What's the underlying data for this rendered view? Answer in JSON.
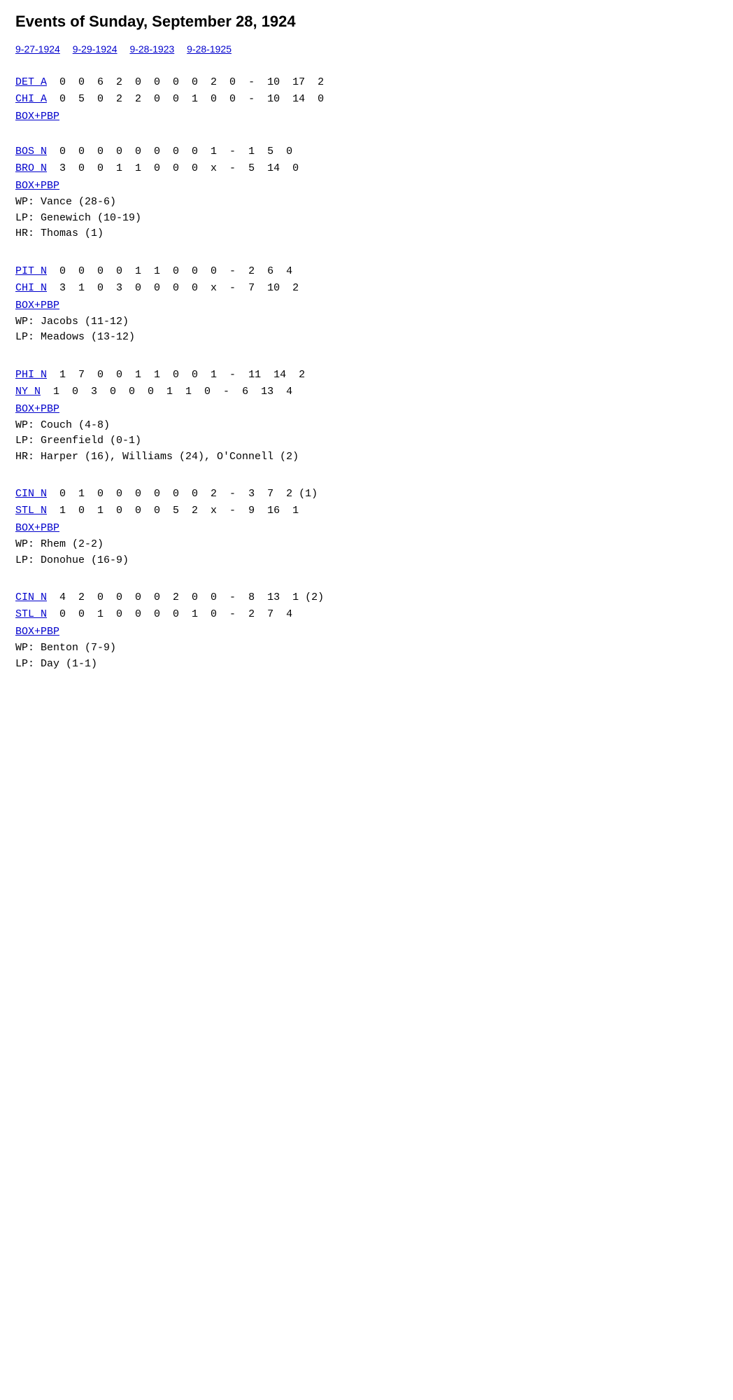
{
  "page": {
    "title": "Events of Sunday, September 28, 1924"
  },
  "nav": {
    "links": [
      {
        "label": "9-27-1924",
        "href": "#"
      },
      {
        "label": "9-29-1924",
        "href": "#"
      },
      {
        "label": "9-28-1923",
        "href": "#"
      },
      {
        "label": "9-28-1925",
        "href": "#"
      }
    ]
  },
  "games": [
    {
      "id": "game1",
      "teams": [
        {
          "name": "DET A",
          "scores": [
            "0",
            "0",
            "6",
            "2",
            "0",
            "0",
            "0",
            "0",
            "2",
            "0",
            "-",
            "10",
            "17",
            "2"
          ],
          "note": ""
        },
        {
          "name": "CHI A",
          "scores": [
            "0",
            "5",
            "0",
            "2",
            "2",
            "0",
            "0",
            "1",
            "0",
            "0",
            "-",
            "10",
            "14",
            "0"
          ],
          "note": ""
        }
      ],
      "box_link": "BOX+PBP",
      "notes": []
    },
    {
      "id": "game2",
      "teams": [
        {
          "name": "BOS N",
          "scores": [
            "0",
            "0",
            "0",
            "0",
            "0",
            "0",
            "0",
            "0",
            "1",
            "-",
            "1",
            "5",
            "0"
          ],
          "note": ""
        },
        {
          "name": "BRO N",
          "scores": [
            "3",
            "0",
            "0",
            "1",
            "1",
            "0",
            "0",
            "0",
            "x",
            "-",
            "5",
            "14",
            "0"
          ],
          "note": ""
        }
      ],
      "box_link": "BOX+PBP",
      "notes": [
        "WP: Vance (28-6)",
        "LP: Genewich (10-19)",
        "HR: Thomas (1)"
      ]
    },
    {
      "id": "game3",
      "teams": [
        {
          "name": "PIT N",
          "scores": [
            "0",
            "0",
            "0",
            "0",
            "1",
            "1",
            "0",
            "0",
            "0",
            "-",
            "2",
            "6",
            "4"
          ],
          "note": ""
        },
        {
          "name": "CHI N",
          "scores": [
            "3",
            "1",
            "0",
            "3",
            "0",
            "0",
            "0",
            "0",
            "x",
            "-",
            "7",
            "10",
            "2"
          ],
          "note": ""
        }
      ],
      "box_link": "BOX+PBP",
      "notes": [
        "WP: Jacobs (11-12)",
        "LP: Meadows (13-12)"
      ]
    },
    {
      "id": "game4",
      "teams": [
        {
          "name": "PHI N",
          "scores": [
            "1",
            "7",
            "0",
            "0",
            "1",
            "1",
            "0",
            "0",
            "1",
            "-",
            "11",
            "14",
            "2"
          ],
          "note": ""
        },
        {
          "name": "NY N",
          "scores": [
            "1",
            "0",
            "3",
            "0",
            "0",
            "0",
            "1",
            "1",
            "0",
            "-",
            "6",
            "13",
            "4"
          ],
          "note": ""
        }
      ],
      "box_link": "BOX+PBP",
      "notes": [
        "WP: Couch (4-8)",
        "LP: Greenfield (0-1)",
        "HR: Harper (16), Williams (24), O'Connell (2)"
      ]
    },
    {
      "id": "game5",
      "teams": [
        {
          "name": "CIN N",
          "scores": [
            "0",
            "1",
            "0",
            "0",
            "0",
            "0",
            "0",
            "0",
            "2",
            "-",
            "3",
            "7",
            "2"
          ],
          "note": "(1)"
        },
        {
          "name": "STL N",
          "scores": [
            "1",
            "0",
            "1",
            "0",
            "0",
            "0",
            "5",
            "2",
            "x",
            "-",
            "9",
            "16",
            "1"
          ],
          "note": ""
        }
      ],
      "box_link": "BOX+PBP",
      "notes": [
        "WP: Rhem (2-2)",
        "LP: Donohue (16-9)"
      ]
    },
    {
      "id": "game6",
      "teams": [
        {
          "name": "CIN N",
          "scores": [
            "4",
            "2",
            "0",
            "0",
            "0",
            "0",
            "2",
            "0",
            "0",
            "-",
            "8",
            "13",
            "1"
          ],
          "note": "(2)"
        },
        {
          "name": "STL N",
          "scores": [
            "0",
            "0",
            "1",
            "0",
            "0",
            "0",
            "0",
            "1",
            "0",
            "-",
            "2",
            "7",
            "4"
          ],
          "note": ""
        }
      ],
      "box_link": "BOX+PBP",
      "notes": [
        "WP: Benton (7-9)",
        "LP: Day (1-1)"
      ]
    }
  ]
}
